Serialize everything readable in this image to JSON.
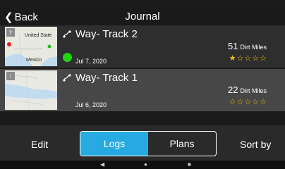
{
  "header": {
    "back_label": "Back",
    "title": "Journal"
  },
  "tracks": [
    {
      "name": "Way- Track 2",
      "date": "Jul 7, 2020",
      "miles": "51",
      "miles_unit": "Dirt Miles",
      "rating": 1,
      "max_rating": 5,
      "map_labels": [
        "United State",
        "Mexico"
      ],
      "status_color": "#1fd60f"
    },
    {
      "name": "Way- Track 1",
      "date": "Jul 6, 2020",
      "miles": "22",
      "miles_unit": "Dirt Miles",
      "rating": 0,
      "max_rating": 5,
      "map_labels": []
    }
  ],
  "toolbar": {
    "edit_label": "Edit",
    "segments": [
      "Logs",
      "Plans"
    ],
    "active_segment": "Logs",
    "sort_label": "Sort by"
  },
  "system_nav": {
    "back_glyph": "◀",
    "home_glyph": "●",
    "recents_glyph": "■"
  },
  "colors": {
    "accent": "#27a9e1",
    "star": "#f0c000",
    "status_green": "#1fd60f"
  }
}
